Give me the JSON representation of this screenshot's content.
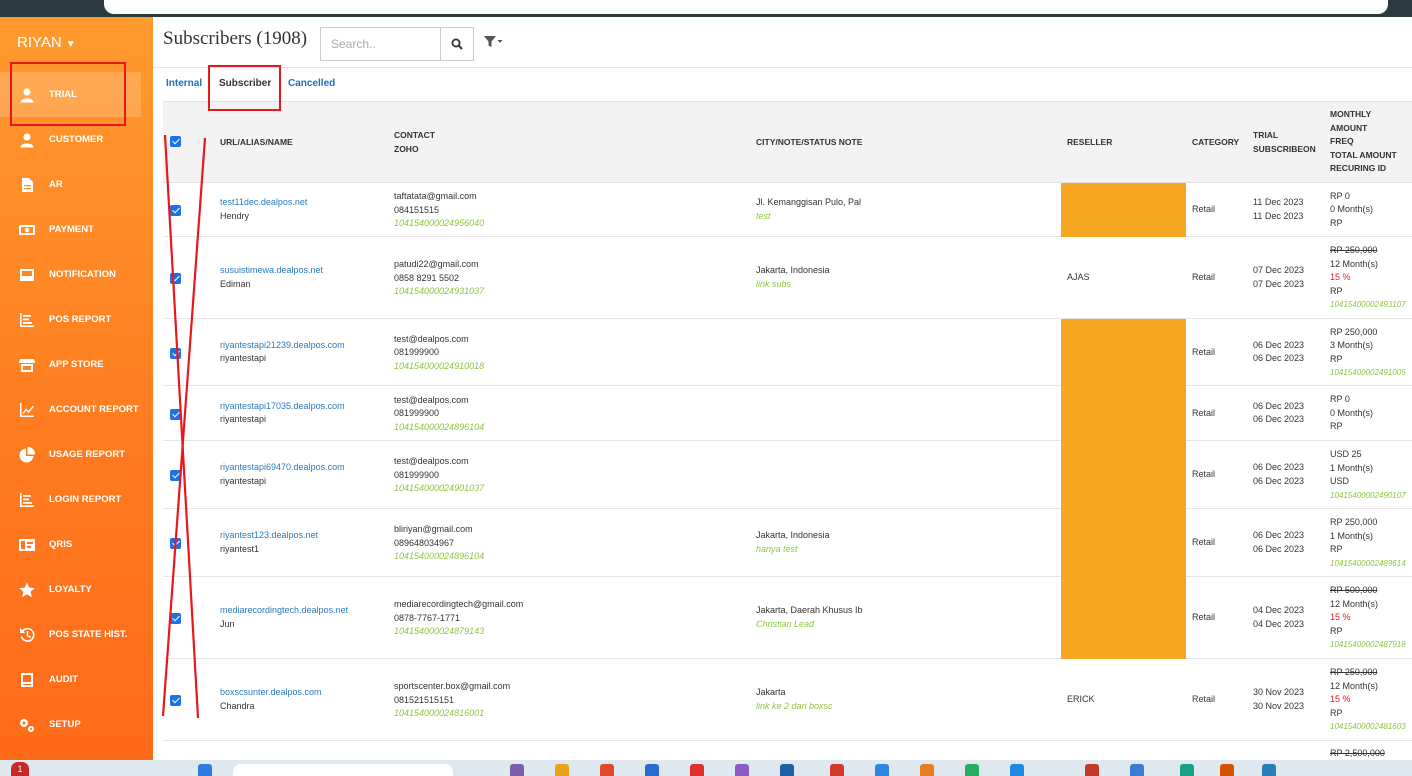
{
  "sidebar": {
    "user": "RIYAN",
    "items": [
      {
        "label": "TRIAL",
        "icon": "user-icon"
      },
      {
        "label": "CUSTOMER",
        "icon": "user-icon"
      },
      {
        "label": "AR",
        "icon": "document-icon"
      },
      {
        "label": "PAYMENT",
        "icon": "money-icon"
      },
      {
        "label": "NOTIFICATION",
        "icon": "inbox-icon"
      },
      {
        "label": "POS REPORT",
        "icon": "list-report-icon"
      },
      {
        "label": "APP STORE",
        "icon": "store-icon"
      },
      {
        "label": "ACCOUNT REPORT",
        "icon": "line-chart-icon"
      },
      {
        "label": "USAGE REPORT",
        "icon": "pie-chart-icon"
      },
      {
        "label": "LOGIN REPORT",
        "icon": "list-report-icon"
      },
      {
        "label": "QRIS",
        "icon": "qris-icon"
      },
      {
        "label": "LOYALTY",
        "icon": "star-icon"
      },
      {
        "label": "POS STATE HIST.",
        "icon": "history-icon"
      },
      {
        "label": "AUDIT",
        "icon": "book-icon"
      },
      {
        "label": "SETUP",
        "icon": "gears-icon"
      }
    ]
  },
  "header": {
    "title": "Subscribers (1908)",
    "search_placeholder": "Search.."
  },
  "tabs": [
    "Internal",
    "Subscriber",
    "Cancelled"
  ],
  "columns": {
    "url": "URL/ALIAS/NAME",
    "contact": [
      "CONTACT",
      "ZOHO"
    ],
    "city": "CITY/NOTE/STATUS NOTE",
    "reseller": "RESELLER",
    "category": "CATEGORY",
    "trial": [
      "TRIAL",
      "SUBSCRIBEON"
    ],
    "monthly": [
      "MONTHLY",
      "AMOUNT",
      "FREQ",
      "TOTAL AMOUNT",
      "RECURING ID"
    ]
  },
  "rows": [
    {
      "url": "test11dec.dealpos.net",
      "name": "Hendry",
      "email": "taftatata@gmail.com",
      "phone": "084151515",
      "zoho": "104154000024956040",
      "city": "Jl. Kemanggisan Pulo, Pal",
      "note": "test",
      "reseller": "",
      "reseller_block": true,
      "category": "Retail",
      "trial": "11 Dec 2023",
      "subscribe": "11 Dec 2023",
      "amount": "RP 0",
      "amount_strike": false,
      "freq": "0 Month(s)",
      "discount": "",
      "total": "RP",
      "recurring": ""
    },
    {
      "url": "susuistimewa.dealpos.net",
      "name": "Ediman",
      "email": "patudi22@gmail.com",
      "phone": "0858 8291 5502",
      "zoho": "104154000024931037",
      "city": "Jakarta, Indonesia",
      "note": "link subs",
      "reseller": "AJAS",
      "reseller_block": false,
      "category": "Retail",
      "trial": "07 Dec 2023",
      "subscribe": "07 Dec 2023",
      "amount": "RP 250,000",
      "amount_strike": true,
      "freq": "12 Month(s)",
      "discount": "15 %",
      "total": "RP",
      "recurring": "10415400002493107"
    },
    {
      "url": "riyantestapi21239.dealpos.com",
      "name": "riyantestapi",
      "email": "test@dealpos.com",
      "phone": "081999900",
      "zoho": "104154000024910018",
      "city": "",
      "note": "",
      "reseller": "",
      "reseller_block": true,
      "category": "Retail",
      "trial": "06 Dec 2023",
      "subscribe": "06 Dec 2023",
      "amount": "RP 250,000",
      "amount_strike": false,
      "freq": "3 Month(s)",
      "discount": "",
      "total": "RP",
      "recurring": "10415400002491005"
    },
    {
      "url": "riyantestapi17035.dealpos.com",
      "name": "riyantestapi",
      "email": "test@dealpos.com",
      "phone": "081999900",
      "zoho": "104154000024896104",
      "city": "",
      "note": "",
      "reseller": "",
      "reseller_block": true,
      "category": "Retail",
      "trial": "06 Dec 2023",
      "subscribe": "06 Dec 2023",
      "amount": "RP 0",
      "amount_strike": false,
      "freq": "0 Month(s)",
      "discount": "",
      "total": "RP",
      "recurring": ""
    },
    {
      "url": "riyantestapi69470.dealpos.com",
      "name": "riyantestapi",
      "email": "test@dealpos.com",
      "phone": "081999900",
      "zoho": "104154000024901037",
      "city": "",
      "note": "",
      "reseller": "",
      "reseller_block": true,
      "category": "Retail",
      "trial": "06 Dec 2023",
      "subscribe": "06 Dec 2023",
      "amount": "USD 25",
      "amount_strike": false,
      "freq": "1 Month(s)",
      "discount": "",
      "total": "USD",
      "recurring": "10415400002490107"
    },
    {
      "url": "riyantest123.dealpos.net",
      "name": "riyantest1",
      "email": "bliriyan@gmail.com",
      "phone": "089648034967",
      "zoho": "104154000024896104",
      "city": "Jakarta, Indonesia",
      "note": "hanya test",
      "reseller": "",
      "reseller_block": true,
      "category": "Retail",
      "trial": "06 Dec 2023",
      "subscribe": "06 Dec 2023",
      "amount": "RP 250,000",
      "amount_strike": false,
      "freq": "1 Month(s)",
      "discount": "",
      "total": "RP",
      "recurring": "10415400002489614"
    },
    {
      "url": "mediarecordingtech.dealpos.net",
      "name": "Jun",
      "email": "mediarecordingtech@gmail.com",
      "phone": "0878-7767-1771",
      "zoho": "104154000024879143",
      "city": "Jakarta, Daerah Khusus Ib",
      "note": "Christian Lead",
      "reseller": "",
      "reseller_block": true,
      "category": "Retail",
      "trial": "04 Dec 2023",
      "subscribe": "04 Dec 2023",
      "amount": "RP 500,000",
      "amount_strike": true,
      "freq": "12 Month(s)",
      "discount": "15 %",
      "total": "RP",
      "recurring": "10415400002487918"
    },
    {
      "url": "boxscsunter.dealpos.com",
      "name": "Chandra",
      "email": "sportscenter.box@gmail.com",
      "phone": "081521515151",
      "zoho": "104154000024816001",
      "city": "Jakarta",
      "note": "link ke 2 dari boxsc",
      "reseller": "ERICK",
      "reseller_block": false,
      "category": "Retail",
      "trial": "30 Nov 2023",
      "subscribe": "30 Nov 2023",
      "amount": "RP 250,000",
      "amount_strike": true,
      "freq": "12 Month(s)",
      "discount": "15 %",
      "total": "RP",
      "recurring": "10415400002481603"
    }
  ],
  "partial_row": {
    "amount": "RP 2,500,000"
  },
  "taskbar": {
    "notification_count": "1"
  },
  "colors": {
    "sidebar": "#ff8a26",
    "accent": "#1e6fb5",
    "reseller_block": "#f5a623",
    "annotation": "#e8171d"
  }
}
